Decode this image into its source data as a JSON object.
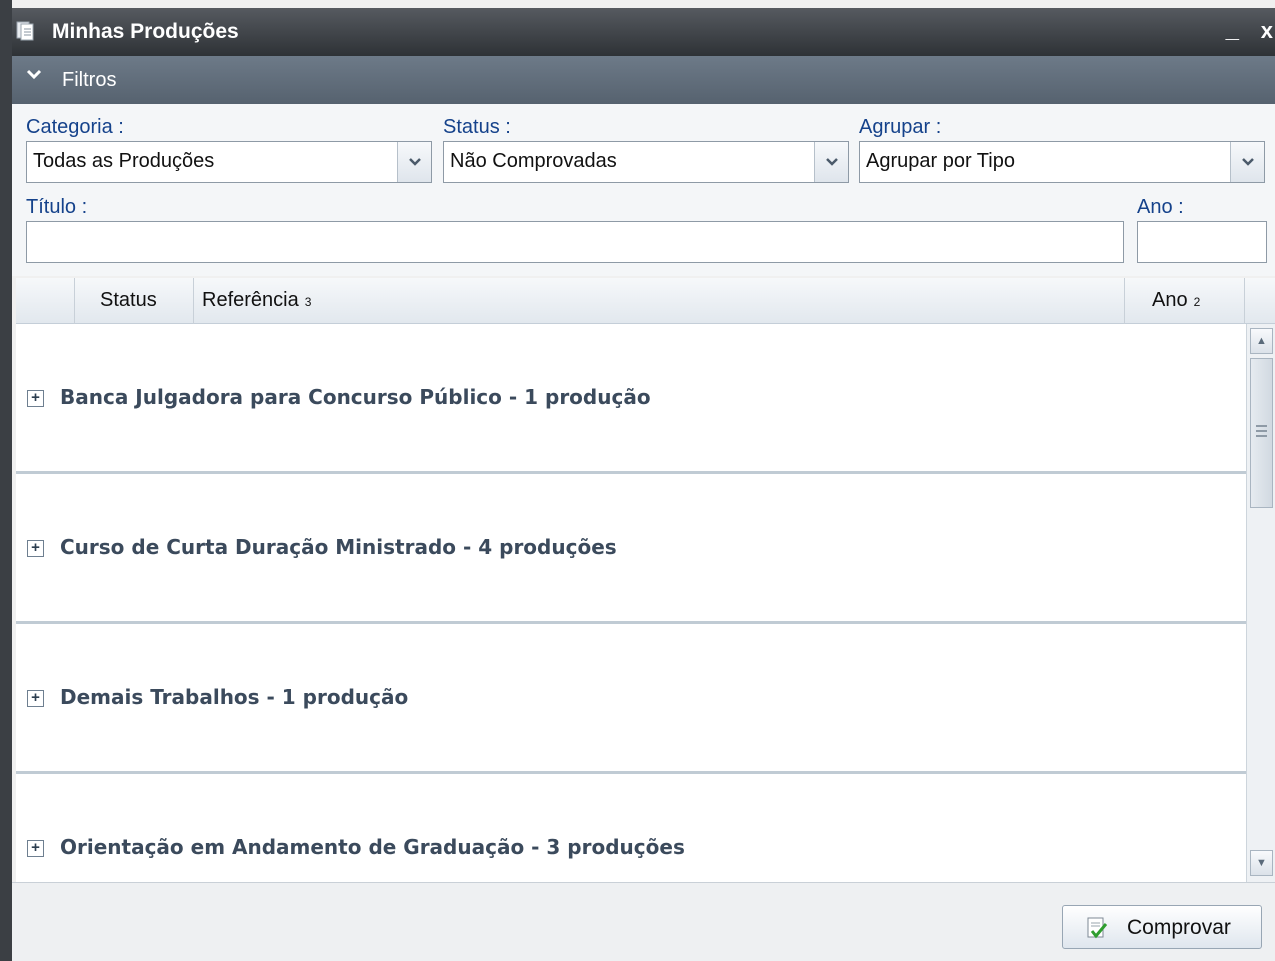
{
  "window": {
    "title": "Minhas Produções",
    "minimize_label": "_",
    "close_label": "x"
  },
  "filters": {
    "header_label": "Filtros",
    "categoria": {
      "label": "Categoria :",
      "value": "Todas as Produções"
    },
    "status": {
      "label": "Status :",
      "value": "Não Comprovadas"
    },
    "agrupar": {
      "label": "Agrupar :",
      "value": "Agrupar por Tipo"
    },
    "titulo": {
      "label": "Título :",
      "value": ""
    },
    "ano": {
      "label": "Ano :",
      "value": ""
    }
  },
  "grid": {
    "columns": {
      "status": "Status",
      "referencia": "Referência",
      "referencia_sort": "3",
      "ano": "Ano",
      "ano_sort": "2"
    },
    "groups": [
      {
        "label": "Banca Julgadora para Concurso Público - 1 produção"
      },
      {
        "label": "Curso de Curta Duração Ministrado - 4 produções"
      },
      {
        "label": "Demais Trabalhos - 1 produção"
      },
      {
        "label": "Orientação em Andamento de Graduação - 3 produções"
      }
    ]
  },
  "footer": {
    "comprovar_label": "Comprovar"
  },
  "colors": {
    "title_bar": "#3a3e43",
    "filter_bar": "#5f6c79",
    "label_blue": "#15428b",
    "group_text": "#3b4a5c"
  },
  "icons": {
    "window": "documents-icon",
    "chevron": "chevron-down-icon",
    "expand": "plus-box-icon",
    "comprovar": "document-check-icon"
  }
}
